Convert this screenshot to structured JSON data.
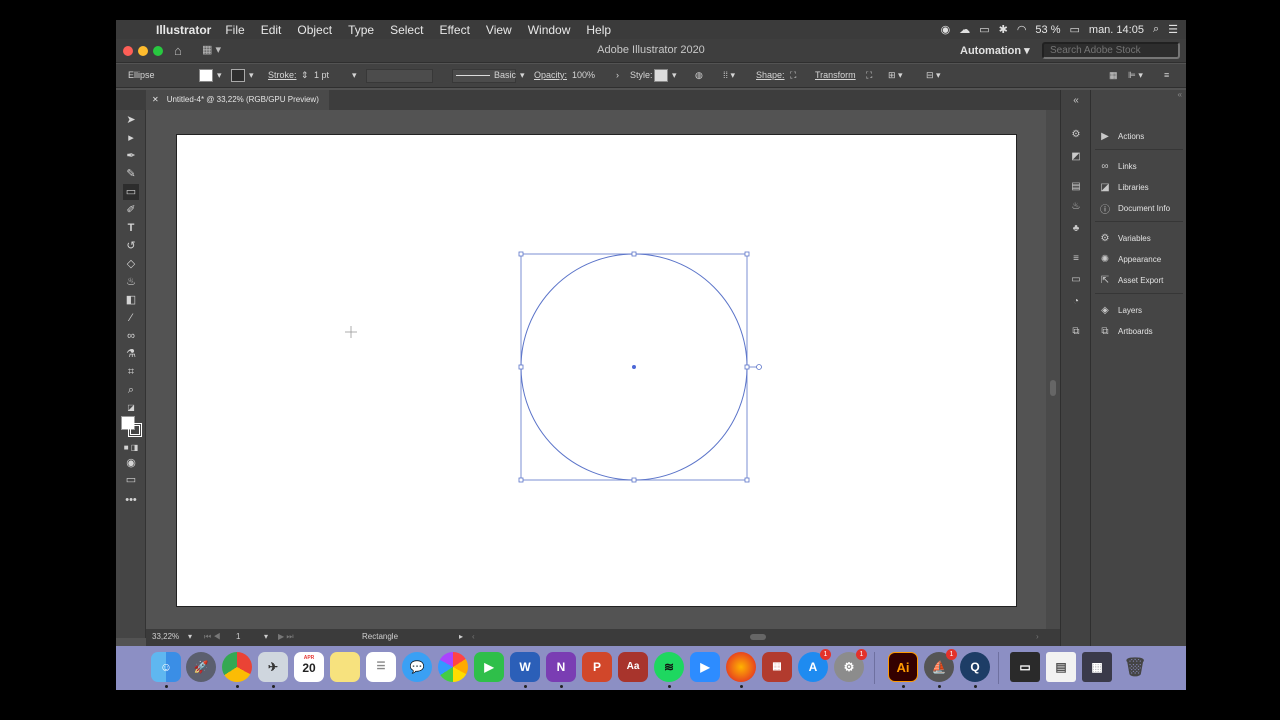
{
  "menubar": {
    "app_name": "Illustrator",
    "items": [
      "File",
      "Edit",
      "Object",
      "Type",
      "Select",
      "Effect",
      "View",
      "Window",
      "Help"
    ],
    "battery": "53 %",
    "clock": "man. 14:05"
  },
  "titlebar": {
    "title": "Adobe Illustrator 2020",
    "workspace": "Automation",
    "search_placeholder": "Search Adobe Stock"
  },
  "control": {
    "object_type": "Ellipse",
    "stroke_label": "Stroke:",
    "stroke_weight": "1 pt",
    "brush_label": "Basic",
    "opacity_label": "Opacity:",
    "opacity_value": "100%",
    "style_label": "Style:",
    "shape_label": "Shape:",
    "transform_label": "Transform"
  },
  "document": {
    "tab_title": "Untitled-4* @ 33,22% (RGB/GPU Preview)"
  },
  "status": {
    "zoom": "33,22%",
    "artboard_number": "1",
    "current_tool": "Rectangle"
  },
  "panels": [
    "Actions",
    "Links",
    "Libraries",
    "Document Info",
    "Variables",
    "Appearance",
    "Asset Export",
    "Layers",
    "Artboards"
  ],
  "dock": {
    "calendar_month": "APR",
    "calendar_day": "20",
    "badge_count": "1",
    "illustrator_label": "Ai",
    "word_label": "W",
    "onenote_label": "N",
    "powerpoint_label": "P"
  },
  "colors": {
    "selection": "#4c67d6",
    "ai_orange": "#ff9a00",
    "dock_bg": "#8c8fc4"
  }
}
